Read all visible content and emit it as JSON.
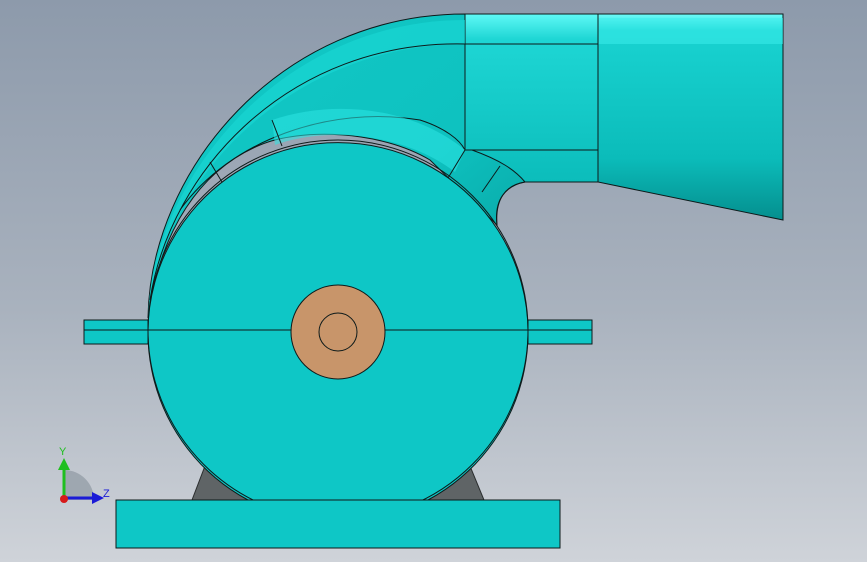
{
  "viewport": {
    "background_top": "#8d9aab",
    "background_bottom": "#cfd3d9"
  },
  "model": {
    "body_color": "#0ec7c6",
    "body_shadow_color": "#05a7a6",
    "duct_highlight_color": "#4ef5f3",
    "outline_color": "#0d1a1a",
    "shaft_color": "#c8956a",
    "support_color": "#5f6466",
    "parts": [
      "volute-scroll",
      "outlet-duct",
      "transition-duct",
      "fan-housing",
      "split-flange",
      "shaft-hub",
      "motor-supports",
      "base-plate"
    ]
  },
  "triad": {
    "y_label": "Y",
    "z_label": "Z",
    "y_color": "#1fbf1f",
    "z_color": "#1a1ad6",
    "x_color": "#d61a1a"
  }
}
